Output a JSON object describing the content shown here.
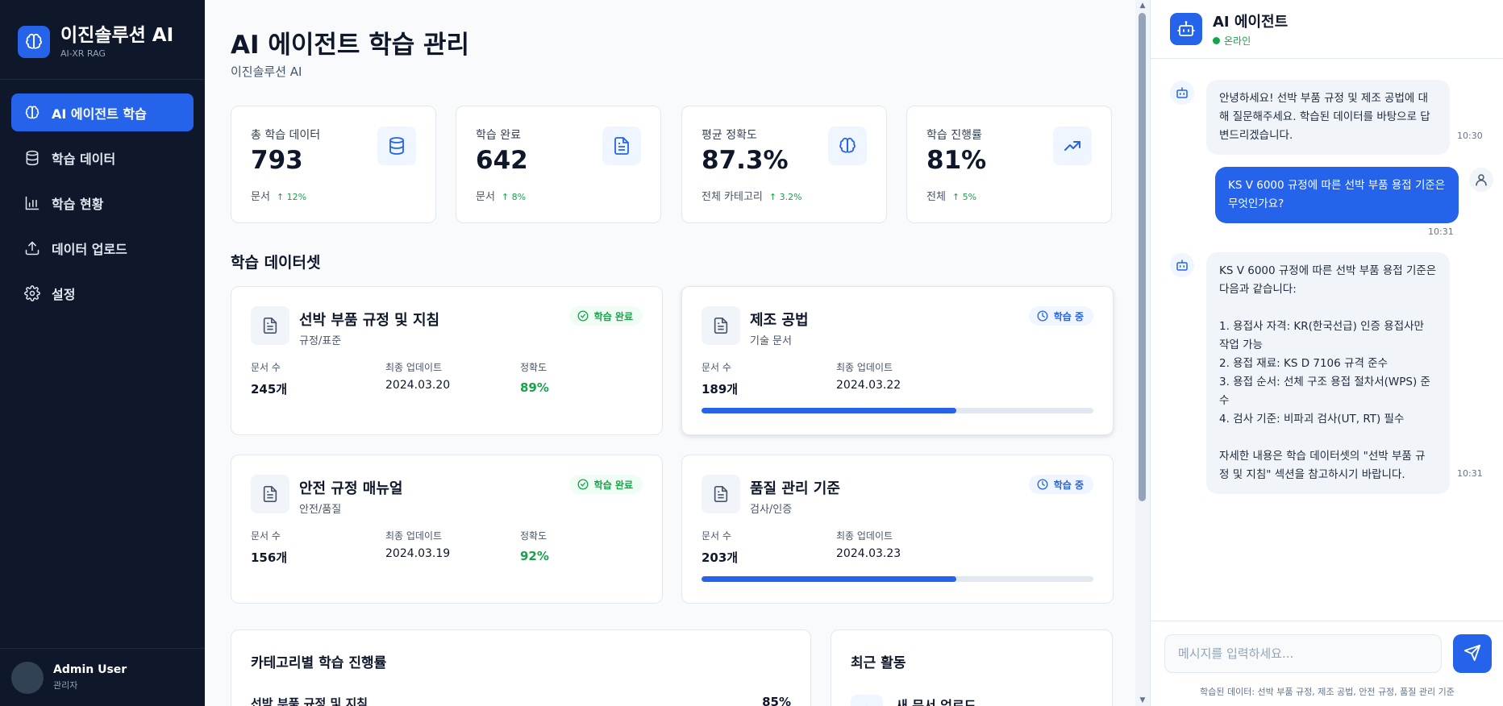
{
  "brand": {
    "title": "이진솔루션 AI",
    "subtitle": "AI-XR RAG"
  },
  "nav": [
    {
      "label": "AI 에이전트 학습",
      "active": true
    },
    {
      "label": "학습 데이터"
    },
    {
      "label": "학습 현황"
    },
    {
      "label": "데이터 업로드"
    },
    {
      "label": "설정"
    }
  ],
  "user": {
    "name": "Admin User",
    "role": "관리자"
  },
  "page": {
    "title": "AI 에이전트 학습 관리",
    "subtitle": "이진솔루션 AI"
  },
  "stats": [
    {
      "label": "총 학습 데이터",
      "value": "793",
      "unit": "문서",
      "trend": "↑ 12%",
      "icon": "database-icon"
    },
    {
      "label": "학습 완료",
      "value": "642",
      "unit": "문서",
      "trend": "↑ 8%",
      "icon": "file-text-icon"
    },
    {
      "label": "평균 정확도",
      "value": "87.3%",
      "unit": "전체 카테고리",
      "trend": "↑ 3.2%",
      "icon": "brain-icon"
    },
    {
      "label": "학습 진행률",
      "value": "81%",
      "unit": "전체",
      "trend": "↑ 5%",
      "icon": "trending-up-icon"
    }
  ],
  "datasets_title": "학습 데이터셋",
  "meta_labels": {
    "docs": "문서 수",
    "updated": "최종 업데이트",
    "accuracy": "정확도"
  },
  "datasets": [
    {
      "name": "선박 부품 규정 및 지침",
      "category": "규정/표준",
      "status": "학습 완료",
      "docs": "245개",
      "updated": "2024.03.20",
      "accuracy": "89%"
    },
    {
      "name": "제조 공법",
      "category": "기술 문서",
      "status": "학습 중",
      "docs": "189개",
      "updated": "2024.03.22",
      "progress": 0.65
    },
    {
      "name": "안전 규정 매뉴얼",
      "category": "안전/품질",
      "status": "학습 완료",
      "docs": "156개",
      "updated": "2024.03.19",
      "accuracy": "92%"
    },
    {
      "name": "품질 관리 기준",
      "category": "검사/인증",
      "status": "학습 중",
      "docs": "203개",
      "updated": "2024.03.23",
      "progress": 0.65
    }
  ],
  "category_panel": {
    "title": "카테고리별 학습 진행률",
    "first_item": "선박 부품 규정 및 지침",
    "first_value": "85%"
  },
  "activity_panel": {
    "title": "최근 활동",
    "first_item": "새 문서 업로드"
  },
  "chat": {
    "title": "AI 에이전트",
    "status": "온라인",
    "messages": [
      {
        "from": "bot",
        "text": "안녕하세요! 선박 부품 규정 및 제조 공법에 대\n해 질문해주세요. 학습된 데이터를 바탕으로 답\n변드리겠습니다.",
        "time": "10:30"
      },
      {
        "from": "user",
        "text": "KS V 6000 규정에 따른 선박 부품 용접 기준은\n무엇인가요?",
        "time": "10:31"
      },
      {
        "from": "bot",
        "text": "KS V 6000 규정에 따른 선박 부품 용접 기준은\n다음과 같습니다:\n\n1. 용접사 자격: KR(한국선급) 인증 용접사만\n작업 가능\n2. 용접 재료: KS D 7106 규격 준수\n3. 용접 순서: 선체 구조 용접 절차서(WPS) 준\n수\n4. 검사 기준: 비파괴 검사(UT, RT) 필수\n\n자세한 내용은 학습 데이터셋의 \"선박 부품 규\n정 및 지침\" 섹션을 참고하시기 바랍니다.",
        "time": "10:31"
      }
    ],
    "input_placeholder": "메시지를 입력하세요...",
    "footer": "학습된 데이터: 선박 부품 규정, 제조 공법, 안전 규정, 품질 관리 기준"
  },
  "colors": {
    "accent": "#2563eb",
    "sidebar": "#0f172a",
    "success": "#16a34a"
  }
}
